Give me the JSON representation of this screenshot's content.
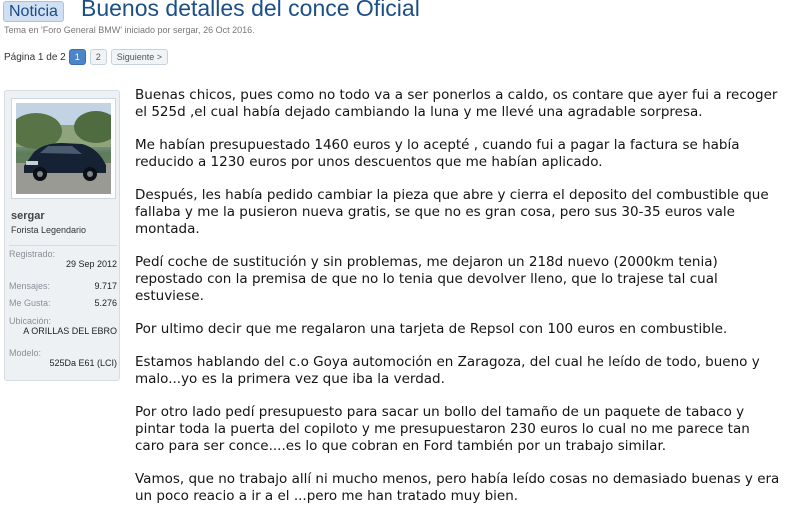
{
  "header": {
    "badge": "Noticia",
    "title": "Buenos detalles del conce Oficial",
    "meta_prefix": "Tema en '",
    "forum": "Foro General BMW",
    "meta_middle": "' iniciado por ",
    "author": "sergar",
    "meta_sep": ", ",
    "date": "26 Oct 2016",
    "meta_end": "."
  },
  "pager": {
    "info": "Página 1 de 2",
    "pages": [
      "1",
      "2"
    ],
    "next": "Siguiente >"
  },
  "user": {
    "name": "sergar",
    "title": "Forista Legendario",
    "registered_label": "Registrado:",
    "registered_value": "29 Sep 2012",
    "messages_label": "Mensajes:",
    "messages_value": "9.717",
    "likes_label": "Me Gusta:",
    "likes_value": "5.276",
    "location_label": "Ubicación:",
    "location_value": "A ORILLAS DEL EBRO",
    "model_label": "Modelo:",
    "model_value": "525Da E61 (LCI)"
  },
  "post": {
    "p1_l1": "Buenas chicos, pues como no todo va a ser ponerlos a caldo, os contare que ayer fui a recoger",
    "p1_l2": "el 525d ,el cual había dejado cambiando la luna y me llevé una agradable sorpresa.",
    "p2_l1": "Me habían presupuestado 1460 euros y lo acepté , cuando fui a pagar la factura se había",
    "p2_l2": "reducido a 1230 euros por unos descuentos que me habían aplicado.",
    "p3_l1": "Después, les había pedido cambiar la pieza que abre y cierra el deposito del combustible que",
    "p3_l2": "fallaba y me la pusieron nueva gratis, se que no es gran cosa, pero sus 30-35 euros vale",
    "p3_l3": "montada.",
    "p4_l1": "Pedí coche de sustitución y sin problemas, me dejaron un 218d nuevo (2000km tenia)",
    "p4_l2": "repostado con la premisa de que no lo tenia que devolver lleno, que lo trajese tal cual",
    "p4_l3": "estuviese.",
    "p5_l1": "Por ultimo decir que me regalaron una tarjeta de Repsol con 100 euros en combustible.",
    "p6_l1": "Estamos hablando del c.o Goya automoción en Zaragoza, del cual he leído de todo, bueno y",
    "p6_l2": "malo...yo es la primera vez que iba la verdad.",
    "p7_l1": "Por otro lado pedí presupuesto para sacar un bollo del tamaño de un paquete de tabaco y",
    "p7_l2": "pintar toda la puerta del copiloto y me presupuestaron 230 euros lo cual no me parece tan",
    "p7_l3": "caro para ser conce....es lo que cobran en Ford también por un trabajo similar.",
    "p8_l1": "Vamos, que no trabajo allí ni mucho menos, pero había leído cosas no demasiado buenas y era",
    "p8_l2": "un poco reacio a ir a el ...pero me han tratado muy bien."
  }
}
